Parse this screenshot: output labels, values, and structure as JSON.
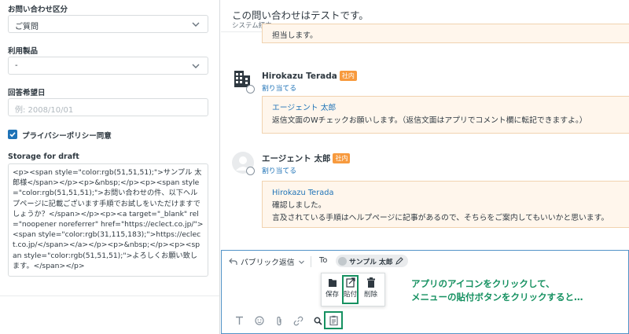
{
  "form": {
    "inquiry_type_label": "お問い合わせ区分",
    "inquiry_type_value": "ご質問",
    "product_label": "利用製品",
    "product_value": "-",
    "desired_date_label": "回答希望日",
    "desired_date_placeholder": "例: 2008/10/01",
    "privacy_label": "プライバシーポリシー同意",
    "privacy_checked": true,
    "draft_label": "Storage for draft",
    "draft_value": "<p><span style=\"color:rgb(51,51,51);\">サンプル 太郎様</span></p><p>&nbsp;</p><p><span style=\"color:rgb(51,51,51);\">お問い合わせの件、以下ヘルプページに記載ございます手順でお試しをいただけますでしょうか？</span></p><p><a target=\"_blank\" rel=\"noopener noreferrer\" href=\"https://eclect.co.jp/\"><span style=\"color:rgb(31,115,183);\">https://eclect.co.jp/</span></a></p><p>&nbsp;</p><p><span style=\"color:rgb(51,51,51);\">よろしくお願い致します。</span></p>"
  },
  "ticket": {
    "subject": "この問い合わせはテストです。",
    "via": "システム経由"
  },
  "messages": [
    {
      "fragment": "担当します。"
    },
    {
      "author": "Hirokazu Terada",
      "tag": "社内",
      "assign": "割り当てる",
      "mention": "エージェント 太郎",
      "body": "返信文面のWチェックお願いします。（返信文面はアプリでコメント欄に転記できますよ。）"
    },
    {
      "author": "エージェント 太郎",
      "tag": "社内",
      "assign": "割り当てる",
      "mention": "Hirokazu Terada",
      "body1": "確認しました。",
      "body2": "言及されている手順はヘルプページに記事があるので、そちらをご案内してもいいかと思います。"
    }
  ],
  "composer": {
    "reply_type": "パブリック返信",
    "to_label": "To",
    "recipient": "サンプル 太郎",
    "app_menu": {
      "save": "保存",
      "paste": "貼付",
      "delete": "削除"
    },
    "callout_line1": "アプリのアイコンをクリックして、",
    "callout_line2": "メニューの貼付ボタンをクリックすると…"
  },
  "colors": {
    "accent_blue": "#1f73b7",
    "internal_tag": "#f79a3e",
    "note_bg": "#fff6ec",
    "highlight_green": "#169161"
  },
  "icons": [
    "chevron-down-icon",
    "check-icon",
    "building-icon",
    "user-icon",
    "reply-icon",
    "pencil-icon",
    "save-icon",
    "paste-icon",
    "trash-icon",
    "text-format-icon",
    "emoji-icon",
    "attachment-icon",
    "link-icon",
    "search-icon",
    "app-icon"
  ]
}
